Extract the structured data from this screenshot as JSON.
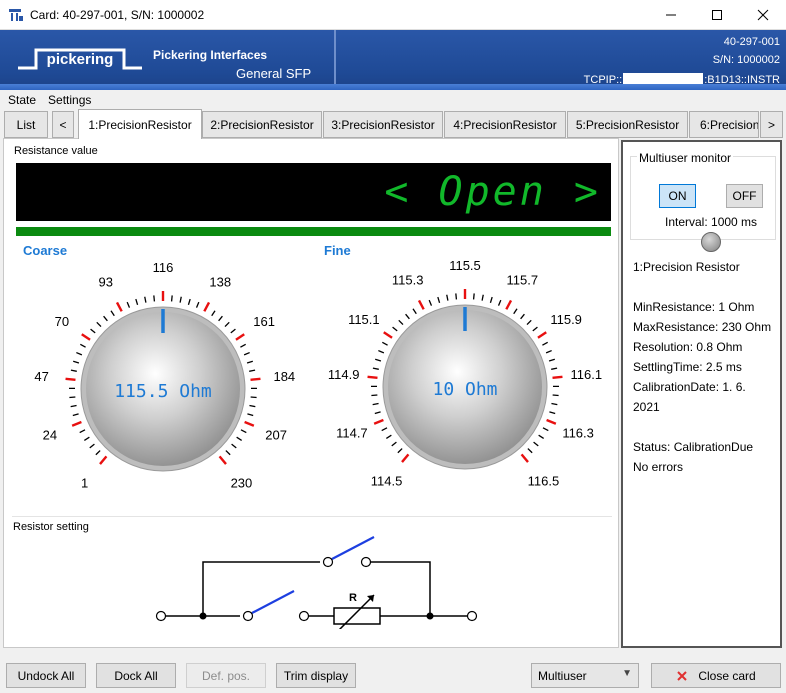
{
  "window": {
    "title": "Card: 40-297-001,  S/N: 1000002",
    "controls": [
      "minimize",
      "maximize",
      "close"
    ]
  },
  "header": {
    "logo_text": "pickering",
    "brand_line1": "Pickering Interfaces",
    "brand_line2": "General SFP",
    "card_id": "40-297-001",
    "serial": "S/N: 1000002",
    "resource_prefix": "TCPIP::",
    "resource_suffix": ":B1D13::INSTR"
  },
  "menu": {
    "items": [
      "State",
      "Settings"
    ]
  },
  "tabs": {
    "list_label": "List",
    "prev_label": "<",
    "next_label": ">",
    "items": [
      "1:PrecisionResistor",
      "2:PrecisionResistor",
      "3:PrecisionResistor",
      "4:PrecisionResistor",
      "5:PrecisionResistor",
      "6:Precision"
    ],
    "active_index": 0
  },
  "resistance": {
    "group_label": "Resistance value",
    "display_value": "< Open >",
    "display_color": "#11b82a"
  },
  "coarse": {
    "title": "Coarse",
    "readout": "115.5 Ohm",
    "scale_labels": [
      "1",
      "24",
      "47",
      "70",
      "93",
      "116",
      "138",
      "161",
      "184",
      "207",
      "230"
    ]
  },
  "fine": {
    "title": "Fine",
    "readout": "10 Ohm",
    "scale_labels": [
      "114.5",
      "114.7",
      "114.9",
      "115.1",
      "115.3",
      "115.5",
      "115.7",
      "115.9",
      "116.1",
      "116.3",
      "116.5"
    ]
  },
  "resistor_setting": {
    "group_label": "Resistor setting",
    "symbol_label": "R"
  },
  "monitor": {
    "title": "Multiuser monitor",
    "on_label": "ON",
    "off_label": "OFF",
    "interval": "Interval: 1000 ms"
  },
  "details": {
    "name": "1:Precision Resistor",
    "min_resistance": "MinResistance: 1 Ohm",
    "max_resistance": "MaxResistance: 230 Ohm",
    "resolution": "Resolution: 0.8 Ohm",
    "settling_time": "SettlingTime: 2.5 ms",
    "calibration_date": "CalibrationDate: 1. 6.",
    "calibration_year": "2021",
    "status": "Status: CalibrationDue",
    "errors": "No errors"
  },
  "footer": {
    "undock_all": "Undock All",
    "dock_all": "Dock All",
    "def_pos": "Def. pos.",
    "trim_display": "Trim display",
    "mode_select": "Multiuser",
    "close_card": "Close card"
  },
  "colors": {
    "accent_blue": "#1e7ad4",
    "banner_blue": "#1f4a96",
    "tick_red": "#e81010",
    "close_red": "#e03030"
  }
}
